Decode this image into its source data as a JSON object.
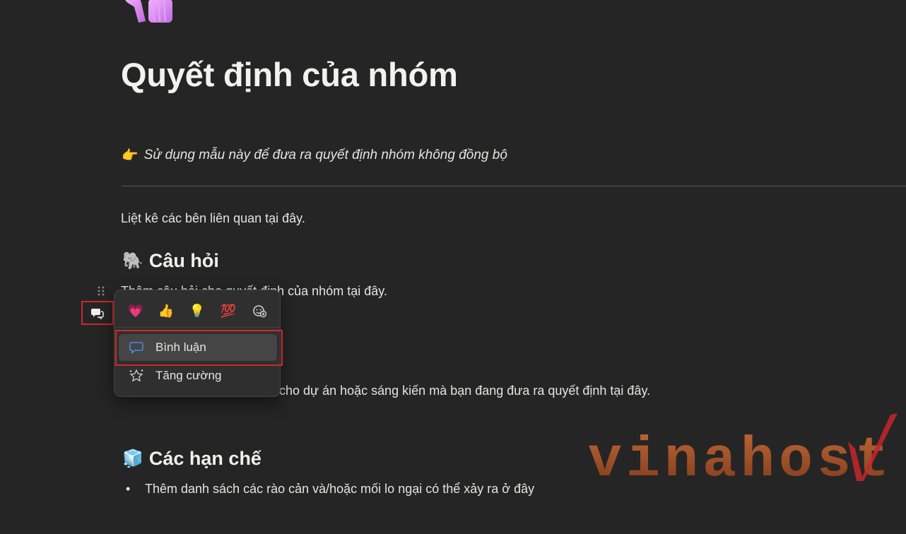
{
  "page": {
    "title": "Quyết định của nhóm",
    "callout_emoji": "👉",
    "callout_text": "Sử dụng mẫu này để đưa ra quyết định nhóm không đồng bộ",
    "stakeholders_text": "Liệt kê các bên liên quan tại đây.",
    "questions_heading": "Câu hỏi",
    "questions_emoji": "🐘",
    "questions_text": "Thêm câu hỏi cho quyết định của nhóm tại đây.",
    "context_text": "cho dự án hoặc sáng kiến mà bạn đang đưa ra quyết định tại đây.",
    "limits_heading": "Các hạn chế",
    "limits_emoji": "🧊",
    "limits_bullet": "Thêm danh sách các rào cản và/hoặc mối lo ngại có thể xảy ra ở đây"
  },
  "popup": {
    "reactions": [
      {
        "name": "heart-reaction",
        "glyph": "💗"
      },
      {
        "name": "thumbs-up-reaction",
        "glyph": "👍"
      },
      {
        "name": "bulb-reaction",
        "glyph": "💡"
      },
      {
        "name": "hundred-reaction",
        "glyph": "💯"
      },
      {
        "name": "add-emoji-reaction",
        "icon": "add-emoji-icon"
      }
    ],
    "comment_label": "Bình luận",
    "boost_label": "Tăng cường"
  },
  "icons": {
    "page_icon": "unicorn-emoji",
    "drag_handle": "drag-handle-icon",
    "comment": "comment-icon",
    "boost": "sparkle-star-icon"
  },
  "watermark": {
    "text": "vinahost."
  },
  "colors": {
    "background": "#252525",
    "popup_bg": "#2f2f2f",
    "highlight_red": "#d02828",
    "comment_icon_blue": "#4a8fe0",
    "watermark_orange": "#d05a1e"
  }
}
